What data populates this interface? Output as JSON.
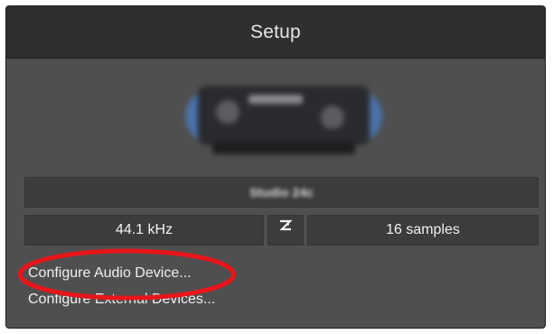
{
  "window": {
    "title": "Setup"
  },
  "device": {
    "name": "Studio 24c"
  },
  "settings": {
    "sample_rate": "44.1 kHz",
    "buffer_size": "16 samples"
  },
  "links": {
    "configure_audio": "Configure Audio Device...",
    "configure_external": "Configure External Devices..."
  },
  "icons": {
    "latency": "z-latency-icon"
  },
  "colors": {
    "panel_background": "#4f4f4f",
    "titlebar_background": "#2f2f2f",
    "field_background": "#3c3c3c",
    "highlight_ring": "#e8161b",
    "device_glow": "#4a78b8"
  }
}
